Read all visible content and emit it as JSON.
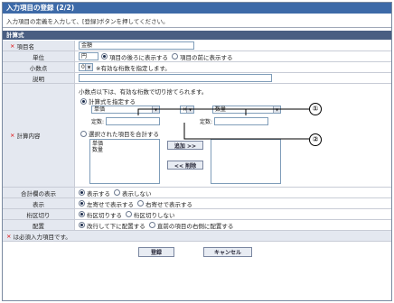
{
  "window": {
    "title": "入力項目の登録 (2/2)"
  },
  "instruction": "入力項目の定義を入力して、[登録]ボタンを押してください。",
  "section_title": "計算式",
  "fields": {
    "item_name": {
      "label": "項目名",
      "value": "金額"
    },
    "unit": {
      "label": "単位",
      "value": "円",
      "opt_after": "項目の後ろに表示する",
      "opt_before": "項目の前に表示する"
    },
    "decimal": {
      "label": "小数点",
      "value": "0",
      "note": "※有効な桁数を指定します。"
    },
    "description": {
      "label": "説明",
      "value": ""
    },
    "calc": {
      "label": "計算内容",
      "note": "小数点以下は、有効な桁数で切り捨てられます。",
      "opt_formula": "計算式を指定する",
      "operand1": "単価",
      "operator": "×",
      "operand2": "数量",
      "const_label": "定数:",
      "opt_sum": "選択された項目を合計する",
      "list_items": [
        "単価",
        "数量"
      ],
      "add_button": "追加 >>",
      "remove_button": "<< 削除"
    },
    "total": {
      "label": "合計欄の表示",
      "opt_show": "表示する",
      "opt_hide": "表示しない"
    },
    "display": {
      "label": "表示",
      "opt_left": "左寄せで表示する",
      "opt_right": "右寄せで表示する"
    },
    "wrap": {
      "label": "桁区切り",
      "opt_on": "桁区切りする",
      "opt_off": "桁区切りしない"
    },
    "layout": {
      "label": "配置",
      "opt_next": "改行して下に配置する",
      "opt_right": "直前の項目の右側に配置する"
    }
  },
  "required_note": "は必須入力項目です。",
  "buttons": {
    "register": "登録",
    "cancel": "キャンセル"
  },
  "callouts": {
    "one": "①",
    "two": "②"
  }
}
